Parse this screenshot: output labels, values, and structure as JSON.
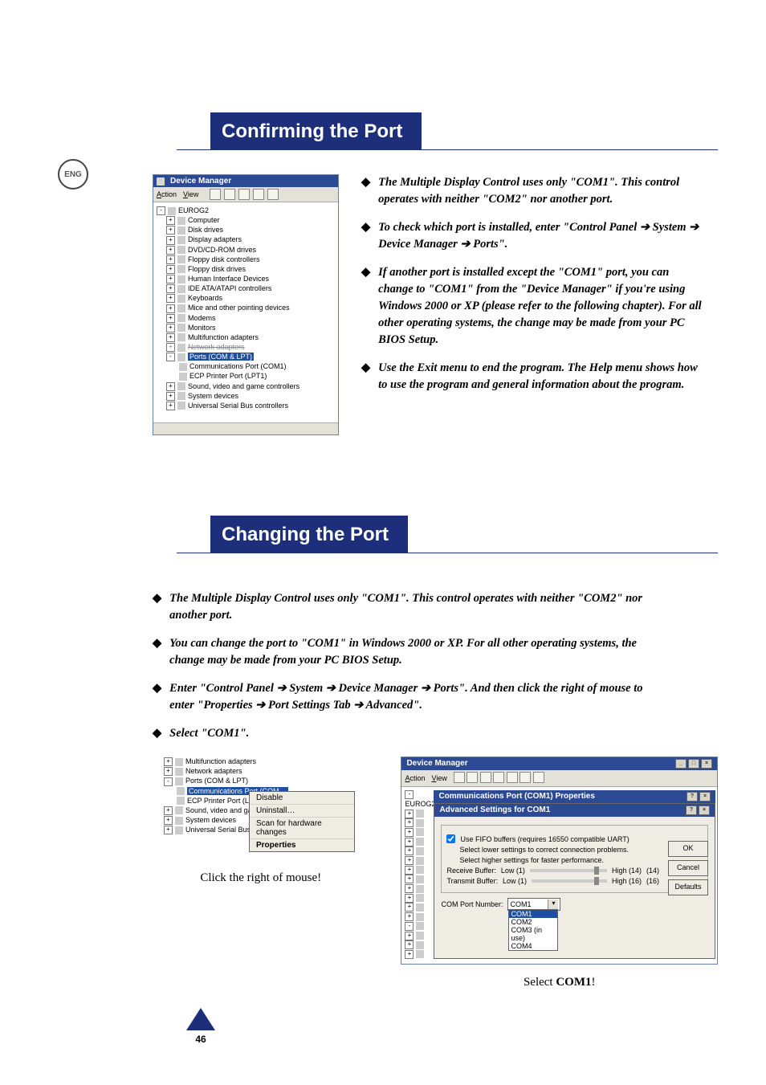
{
  "lang_badge": "ENG",
  "section1_title": "Confirming the Port",
  "dm": {
    "title": "Device Manager",
    "menu_action": "Action",
    "menu_view": "View",
    "root": "EUROG2",
    "nodes": [
      "Computer",
      "Disk drives",
      "Display adapters",
      "DVD/CD-ROM drives",
      "Floppy disk controllers",
      "Floppy disk drives",
      "Human Interface Devices",
      "IDE ATA/ATAPI controllers",
      "Keyboards",
      "Mice and other pointing devices",
      "Modems",
      "Monitors",
      "Multifunction adapters",
      "Network adapters",
      "Ports (COM & LPT)",
      "Sound, video and game controllers",
      "System devices",
      "Universal Serial Bus controllers"
    ],
    "port_children": [
      "Communications Port (COM1)",
      "ECP Printer Port (LPT1)"
    ]
  },
  "s1_bullets": [
    "The Multiple Display Control uses only \"COM1\". This control operates with neither \"COM2\" nor another port.",
    "To check which port is installed, enter \"Control Panel ➔ System ➔ Device Manager ➔ Ports\".",
    "If another port is installed except the \"COM1\" port, you can change to \"COM1\" from the \"Device Manager\" if you're using Windows 2000 or XP (please refer to the following chapter). For all other operating systems, the change may be made from your PC BIOS Setup.",
    "Use the Exit menu to end the program. The Help menu shows how to use the program and general information about the program."
  ],
  "section2_title": "Changing the Port",
  "s2_bullets": [
    "The Multiple Display Control uses only \"COM1\". This control operates with neither \"COM2\" nor another port.",
    "You can change the port to \"COM1\" in Windows 2000 or XP. For all other operating systems, the change may be made from your PC BIOS Setup.",
    "Enter \"Control Panel ➔ System ➔ Device Manager ➔ Ports\". And then click the right of mouse to enter \"Properties ➔ Port Settings Tab ➔ Advanced\".",
    "Select \"COM1\"."
  ],
  "small_tree": {
    "nodes": [
      "Multifunction adapters",
      "Network adapters",
      "Ports (COM & LPT)",
      "Sound, video and game controllers",
      "System devices",
      "Universal Serial Bus controllers"
    ],
    "children": [
      "Communications Port (COM…",
      "ECP Printer Port (LPT1)"
    ]
  },
  "ctx": {
    "disable": "Disable",
    "uninstall": "Uninstall…",
    "scan": "Scan for hardware changes",
    "properties": "Properties"
  },
  "caption_left": "Click the right of mouse!",
  "adv": {
    "dm_title": "Device Manager",
    "root": "EUROG2",
    "prop_title": "Communications Port (COM1) Properties",
    "adv_title": "Advanced Settings for COM1",
    "fifo_label": "Use FIFO buffers (requires 16550 compatible UART)",
    "hint1": "Select lower settings to correct connection problems.",
    "hint2": "Select higher settings for faster performance.",
    "recv_label": "Receive Buffer:",
    "trans_label": "Transmit Buffer:",
    "low": "Low (1)",
    "high14": "High (14)",
    "high16": "High (16)",
    "v14": "(14)",
    "v16": "(16)",
    "portnum_label": "COM Port Number:",
    "combo_value": "COM1",
    "options": [
      "COM1",
      "COM2",
      "COM3 (in use)",
      "COM4"
    ],
    "ok": "OK",
    "cancel": "Cancel",
    "defaults": "Defaults"
  },
  "caption_right_prefix": "Select ",
  "caption_right_bold": "COM1",
  "caption_right_suffix": "!",
  "page_number": "46"
}
